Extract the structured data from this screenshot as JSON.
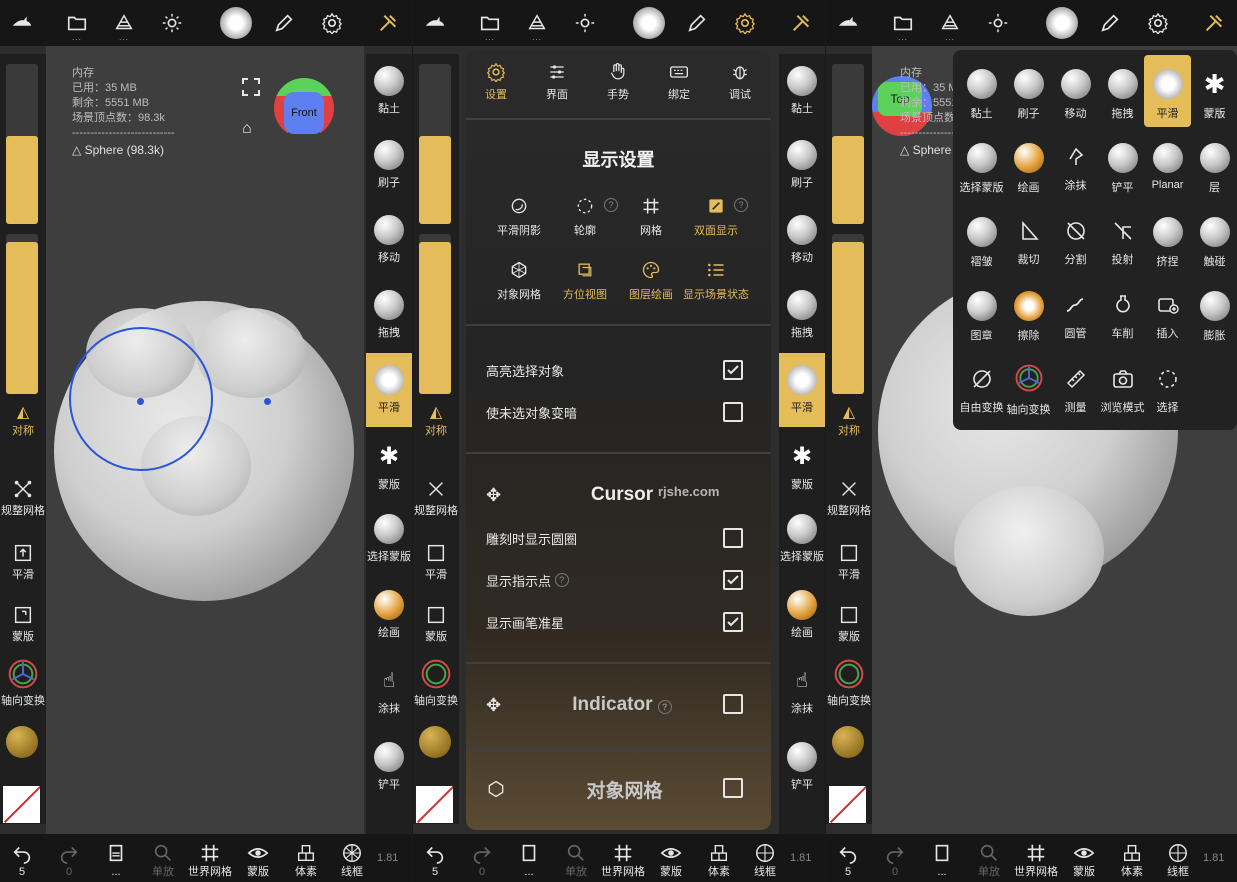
{
  "top_icons": [
    "shark-logo-icon",
    "folder-icon",
    "scene-icon",
    "sun-icon",
    "brush-preview-icon",
    "pen-icon",
    "gear-icon",
    "tools-icon"
  ],
  "left": {
    "symmetry_label": "对称",
    "tools": [
      "规整网格",
      "平滑",
      "蒙版",
      "轴向变换"
    ]
  },
  "right_tools": [
    {
      "label": "黏土",
      "active": false
    },
    {
      "label": "刷子",
      "active": false
    },
    {
      "label": "移动",
      "active": false
    },
    {
      "label": "拖拽",
      "active": false
    },
    {
      "label": "平滑",
      "active": true
    },
    {
      "label": "蒙版",
      "active": false
    },
    {
      "label": "选择蒙版",
      "active": false
    },
    {
      "label": "绘画",
      "active": false
    },
    {
      "label": "涂抹",
      "active": false
    },
    {
      "label": "铲平",
      "active": false
    }
  ],
  "info": {
    "memory_title": "内存",
    "used": "已用：35 MB",
    "free": "剩余：5551 MB",
    "vertices": "场景顶点数：98.3k",
    "divider": "----------------------------",
    "object": "Sphere (98.3k)"
  },
  "gizmo": {
    "front": "Front",
    "top": "Top"
  },
  "bottom": {
    "items": [
      {
        "label": "5",
        "icon": "undo-icon"
      },
      {
        "label": "0",
        "icon": "redo-icon"
      },
      {
        "label": "...",
        "icon": "layers-icon"
      },
      {
        "label": "单放",
        "icon": "search-icon"
      },
      {
        "label": "世界网格",
        "icon": "grid-icon"
      },
      {
        "label": "蒙版",
        "icon": "eye-icon"
      },
      {
        "label": "体素",
        "icon": "voxel-icon"
      },
      {
        "label": "线框",
        "icon": "wireframe-icon"
      }
    ],
    "version": "1.81"
  },
  "settings": {
    "tabs": [
      "设置",
      "界面",
      "手势",
      "绑定",
      "调试"
    ],
    "title": "显示设置",
    "display_options": [
      "平滑阴影",
      "轮廓",
      "网格",
      "双面显示",
      "对象网格",
      "方位视图",
      "图层绘画",
      "显示场景状态"
    ],
    "rows": [
      {
        "label": "高亮选择对象",
        "checked": true
      },
      {
        "label": "使未选对象变暗",
        "checked": false
      }
    ],
    "cursor_title": "Cursor",
    "watermark": "rjshe.com",
    "cursor_rows": [
      {
        "label": "雕刻时显示圆圈",
        "checked": false
      },
      {
        "label": "显示指示点",
        "checked": true
      },
      {
        "label": "显示画笔准星",
        "checked": true
      }
    ],
    "indicator_title": "Indicator",
    "mesh_title": "对象网格",
    "help": "?"
  },
  "tool_grid": [
    {
      "label": "黏土",
      "active": false
    },
    {
      "label": "刷子",
      "active": false
    },
    {
      "label": "移动",
      "active": false
    },
    {
      "label": "拖拽",
      "active": false
    },
    {
      "label": "平滑",
      "active": true
    },
    {
      "label": "蒙版",
      "active": false
    },
    {
      "label": "选择蒙版",
      "active": false
    },
    {
      "label": "绘画",
      "active": false
    },
    {
      "label": "涂抹",
      "active": false
    },
    {
      "label": "铲平",
      "active": false
    },
    {
      "label": "Planar",
      "active": false
    },
    {
      "label": "层",
      "active": false
    },
    {
      "label": "褶皱",
      "active": false
    },
    {
      "label": "裁切",
      "active": false
    },
    {
      "label": "分割",
      "active": false
    },
    {
      "label": "投射",
      "active": false
    },
    {
      "label": "挤捏",
      "active": false
    },
    {
      "label": "触碰",
      "active": false
    },
    {
      "label": "图章",
      "active": false
    },
    {
      "label": "擦除",
      "active": false
    },
    {
      "label": "圆管",
      "active": false
    },
    {
      "label": "车削",
      "active": false
    },
    {
      "label": "插入",
      "active": false
    },
    {
      "label": "膨胀",
      "active": false
    },
    {
      "label": "自由变换",
      "active": false
    },
    {
      "label": "轴向变换",
      "active": false
    },
    {
      "label": "测量",
      "active": false
    },
    {
      "label": "浏览模式",
      "active": false
    },
    {
      "label": "选择",
      "active": false
    }
  ],
  "colors": {
    "accent": "#e4bc5a",
    "background": "#2d2d2d",
    "toolbar": "#161616"
  }
}
